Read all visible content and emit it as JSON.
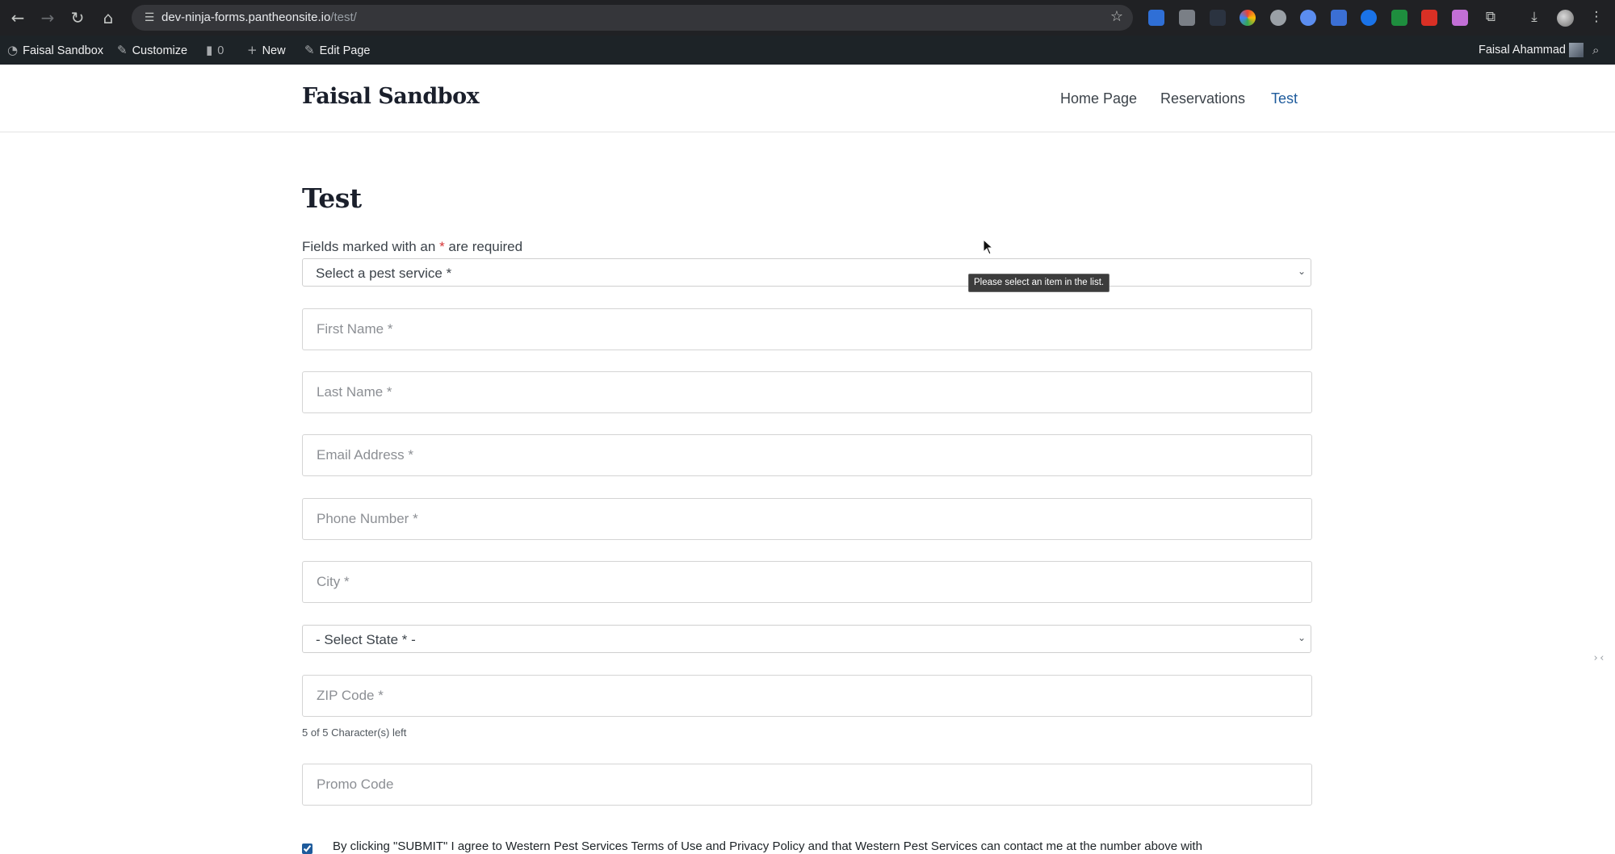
{
  "browser": {
    "url_host": "dev-ninja-forms.pantheonsite.io",
    "url_path": "/test/",
    "icons": {
      "back": "back-arrow-icon",
      "forward": "forward-arrow-icon",
      "reload": "reload-icon",
      "home": "home-icon",
      "site_info": "tune-icon",
      "bookmark": "star-icon",
      "extensions": "puzzle-icon",
      "downloads": "download-icon",
      "menu": "kebab-menu-icon"
    }
  },
  "admin_bar": {
    "site_name": "Faisal Sandbox",
    "customize": "Customize",
    "comments_count": "0",
    "new_label": "New",
    "edit_page": "Edit Page",
    "user_name": "Faisal Ahammad"
  },
  "site": {
    "title": "Faisal Sandbox",
    "nav": [
      {
        "label": "Home Page"
      },
      {
        "label": "Reservations"
      },
      {
        "label": "Test",
        "active": true
      }
    ],
    "active_color": "#1e5b9c"
  },
  "page": {
    "title": "Test",
    "required_note": {
      "prefix": "Fields marked with an ",
      "asterisk": "*",
      "suffix": " are required"
    },
    "form": {
      "service_select": "Select a pest service *",
      "first_name": "First Name *",
      "last_name": "Last Name *",
      "email": "Email Address *",
      "phone": "Phone Number *",
      "city": "City *",
      "state_select": "- Select State * -",
      "zip": "ZIP Code *",
      "zip_counter": "5 of 5 Character(s) left",
      "promo": "Promo Code",
      "consent_checked": true,
      "consent_text": "By clicking \"SUBMIT\" I agree to Western Pest Services Terms of Use and Privacy Policy and that Western Pest Services can contact me at the number above with"
    },
    "validation_tooltip": "Please select an item in the list."
  }
}
